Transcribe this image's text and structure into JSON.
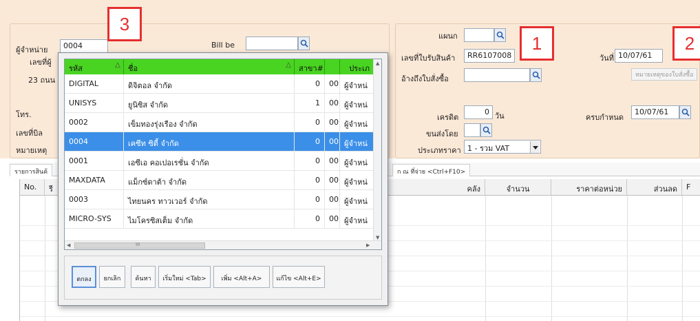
{
  "markers": {
    "m1": "1",
    "m2": "2",
    "m3": "3"
  },
  "left_panel": {
    "supplier_label": "ผู้จำหน่าย",
    "supplier_value": "0004",
    "billto_label": "Bill be",
    "taxid_label": "เลขที่ผู้",
    "address_label": "23 ถนน",
    "phone_label": "โทร.",
    "bill_no_label": "เลขที่บิล",
    "note_label": "หมายเหตุ"
  },
  "right_panel": {
    "dept_label": "แผนก",
    "receipt_no_label": "เลขที่ใบรับสินค้า",
    "receipt_no_value": "RR6107008",
    "ref_po_label": "อ้างถึงใบสั่งซื้อ",
    "date_label": "วันที่",
    "date_value": "10/07/61",
    "po_ref_button": "หมายเหตุของใบสั่งซื้อ",
    "credit_label": "เครดิต",
    "credit_value": "0",
    "credit_unit": "วัน",
    "due_label": "ครบกำหนด",
    "due_value": "10/07/61",
    "shipped_by_label": "ขนส่งโดย",
    "price_type_label": "ประเภทราคา",
    "price_type_value": "1 - รวม VAT"
  },
  "tabs": {
    "items_tab": "รายการสินค้",
    "shortcut_tab": "ก ณ ที่จ่าย <Ctrl+F10>"
  },
  "grid": {
    "headers": {
      "no": "No.",
      "c2": "รี",
      "warehouse": "คลัง",
      "qty": "จำนวน",
      "unit_price": "ราคาต่อหน่วย",
      "discount": "ส่วนลด",
      "f": "F"
    }
  },
  "popup": {
    "headers": {
      "code": "รหัส",
      "name": "ชื่อ",
      "branch": "สาขา#",
      "type": "ประเภ"
    },
    "rows": [
      {
        "code": "DIGITAL",
        "name": "ดิจิตอล จำกัด",
        "branch": "0",
        "sub": "00",
        "type": "ผู้จำหน่"
      },
      {
        "code": "UNISYS",
        "name": "ยูนิซิส จำกัด",
        "branch": "1",
        "sub": "00",
        "type": "ผู้จำหน่"
      },
      {
        "code": "0002",
        "name": "เข็มทองรุ่งเรือง จำกัด",
        "branch": "0",
        "sub": "00",
        "type": "ผู้จำหน่"
      },
      {
        "code": "0004",
        "name": "เคซีท ซิตี้ จำกัด",
        "branch": "0",
        "sub": "00",
        "type": "ผู้จำหน่"
      },
      {
        "code": "0001",
        "name": "เอซีเอ คอเปอเรชั่น จำกัด",
        "branch": "0",
        "sub": "00",
        "type": "ผู้จำหน่"
      },
      {
        "code": "MAXDATA",
        "name": "แม็กซ์ดาต้า จำกัด",
        "branch": "0",
        "sub": "00",
        "type": "ผู้จำหน่"
      },
      {
        "code": "0003",
        "name": "ไทยนคร ทาวเวอร์ จำกัด",
        "branch": "0",
        "sub": "00",
        "type": "ผู้จำหน่"
      },
      {
        "code": "MICRO-SYS",
        "name": "ไมโครซิสเต็ม จำกัด",
        "branch": "0",
        "sub": "00",
        "type": "ผู้จำหน่"
      }
    ],
    "buttons": {
      "ok": "ตกลง",
      "cancel": "ยกเลิก",
      "search": "ค้นหา",
      "new": "เริ่มใหม่ <Tab>",
      "add": "เพิ่ม <Alt+A>",
      "edit": "แก้ไข <Alt+E>"
    },
    "hscroll_grip": "III"
  },
  "colors": {
    "form_bg": "#fbe9d8",
    "popup_header": "#48d420",
    "selected_row": "#3b8fe8",
    "marker": "#e62e2e"
  }
}
